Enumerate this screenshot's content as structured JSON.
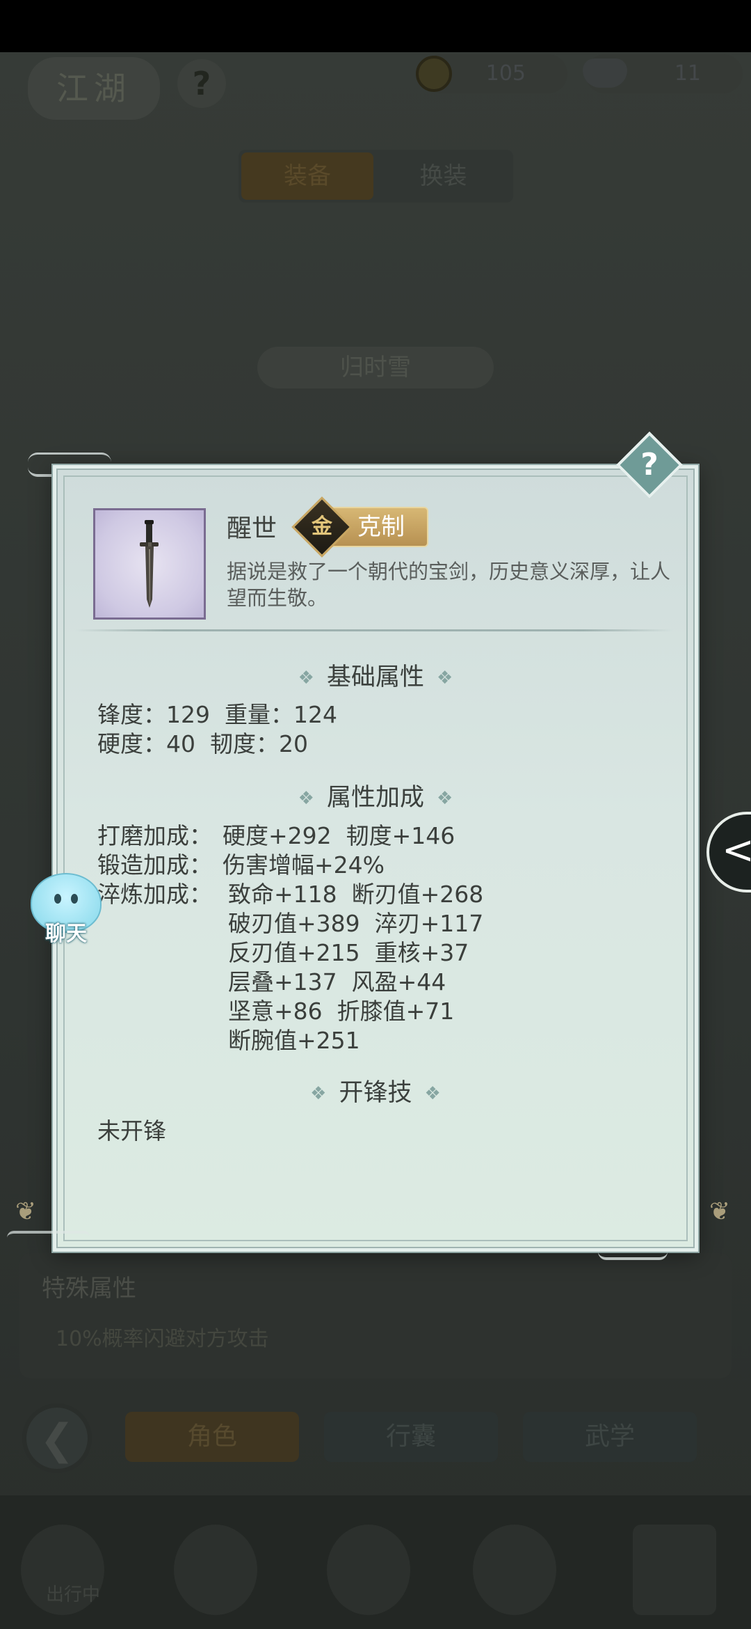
{
  "background": {
    "logo_text": "江湖",
    "help_glyph": "?",
    "currency": [
      {
        "icon": "coin-icon",
        "value": "105"
      },
      {
        "icon": "silver-ingot-icon",
        "value": "11"
      }
    ],
    "tabs": [
      "装备",
      "换装"
    ],
    "character_name": "归时雪",
    "special_title": "特殊属性",
    "special_body": "10%概率闪避对方攻击",
    "nav_tabs": [
      "角色",
      "行囊",
      "武学"
    ],
    "bottom_nav_label": "出行中"
  },
  "dialog": {
    "help_glyph": "?",
    "item": {
      "name": "醒世",
      "badge_glyph": "金",
      "badge_label": "克制",
      "description": "据说是救了一个朝代的宝剑，历史意义深厚，让人望而生敬。"
    },
    "sections": {
      "base": "基础属性",
      "bonus": "属性加成",
      "skill": "开锋技"
    },
    "base_stats": {
      "line1": "锋度：129  重量：124",
      "line2": "硬度：40  韧度：20"
    },
    "bonus_stats": {
      "grind": {
        "label": "打磨加成：",
        "values": "硬度+292  韧度+146"
      },
      "forge": {
        "label": "锻造加成：",
        "values": "伤害增幅+24%"
      },
      "temper": {
        "label": "淬炼加成：",
        "lines": [
          "致命+118  断刃值+268",
          "破刃值+389  淬刃+117",
          "反刃值+215  重核+37",
          "层叠+137  风盈+44",
          "坚意+86  折膝值+71",
          "断腕值+251"
        ]
      }
    },
    "skill_text": "未开锋"
  },
  "chat": {
    "label": "聊天"
  },
  "side_arrow": {
    "glyph": "<"
  }
}
